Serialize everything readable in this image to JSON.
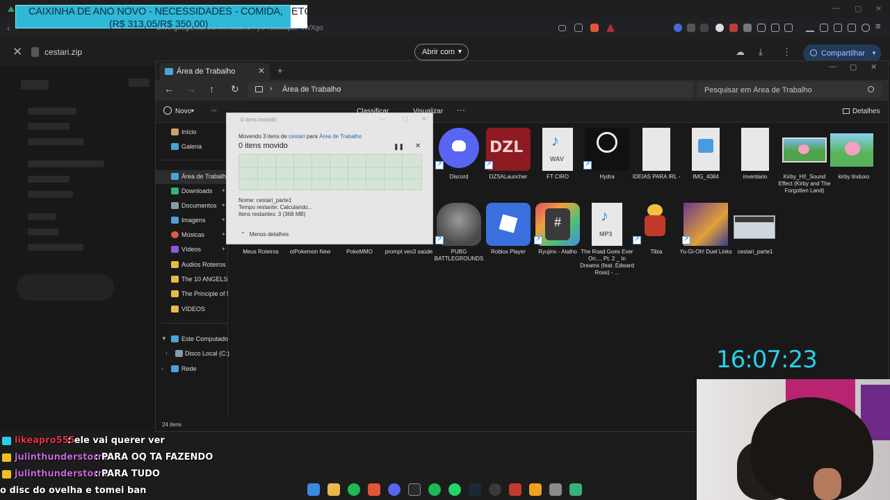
{
  "overlay": {
    "donation_line1": "CAIXINHA DE ANO NOVO - NECESSIDADES - COMIDA,",
    "donation_tail": "ETC.",
    "donation_line2": "(R$ 313,05/R$ 350,00)",
    "clock": "16:07:23"
  },
  "browser": {
    "url": "drive.google.com/drive/folders/...ys/Ts5txbqSIPllWXgo"
  },
  "drive": {
    "file_name": "cestari.zip",
    "open_with_label": "Abrir com",
    "share_label": "Compartilhar"
  },
  "explorer": {
    "tab_title": "Área de Trabalho",
    "path": "Área de Trabalho",
    "search_placeholder": "Pesquisar em Área de Trabalho",
    "new_label": "Novo",
    "sort_label": "Classificar",
    "view_label": "Visualizar",
    "details_label": "Detalhes",
    "status": "24 itens",
    "sidebar": [
      {
        "label": "Início",
        "icon": "home-icon"
      },
      {
        "label": "Galeria",
        "icon": "gallery-icon"
      },
      {
        "label": "Área de Trabalho",
        "icon": "desktop-icon"
      },
      {
        "label": "Downloads",
        "icon": "download-icon"
      },
      {
        "label": "Documentos",
        "icon": "documents-icon"
      },
      {
        "label": "Imagens",
        "icon": "images-icon"
      },
      {
        "label": "Músicas",
        "icon": "music-icon"
      },
      {
        "label": "Vídeos",
        "icon": "video-icon"
      },
      {
        "label": "Audios Roteiros",
        "icon": "folder-icon"
      },
      {
        "label": "The 10 ANGELS Tha",
        "icon": "folder-icon"
      },
      {
        "label": "The Principle of ME",
        "icon": "folder-icon"
      },
      {
        "label": "VIDEOS",
        "icon": "folder-icon"
      },
      {
        "label": "Este Computador",
        "icon": "computer-icon"
      },
      {
        "label": "Disco Local (C:)",
        "icon": "drive-icon"
      },
      {
        "label": "Rede",
        "icon": "network-icon"
      }
    ],
    "files_row1": [
      {
        "name": "Discord",
        "icon": "discord-icon",
        "color": "#5865f2"
      },
      {
        "name": "DZSALauncher",
        "icon": "dzsa-icon",
        "color": "#8e1a22"
      },
      {
        "name": "FT CIRO",
        "icon": "wav-file-icon",
        "color": "#e8e8e8"
      },
      {
        "name": "Hydra",
        "icon": "hydra-icon",
        "color": "#111111"
      },
      {
        "name": "IDEIAS PARA IRL -",
        "icon": "text-file-icon",
        "color": "#e8e8e8"
      },
      {
        "name": "IMG_4084",
        "icon": "image-file-icon",
        "color": "#e8e8e8"
      },
      {
        "name": "inventario",
        "icon": "text-file-icon",
        "color": "#e8e8e8"
      },
      {
        "name": "Kirby_HI!_Sound Effect (Kirby and The Forgotten Land)",
        "icon": "kirby-thumb-icon",
        "color": "#4fa34a"
      },
      {
        "name": "kirby linduxo",
        "icon": "kirby-thumb-icon",
        "color": "#59b35a"
      }
    ],
    "files_row2": [
      {
        "name": "Meus Roteiros",
        "icon": "folder-icon",
        "color": "#e8b84a"
      },
      {
        "name": "otPokemon New",
        "icon": "shortcut-icon",
        "color": "#444444"
      },
      {
        "name": "PokeMMO",
        "icon": "shortcut-icon",
        "color": "#444444"
      },
      {
        "name": "prompt veo3 saúde",
        "icon": "text-file-icon",
        "color": "#e8e8e8"
      },
      {
        "name": "PUBG BATTLEGROUNDS",
        "icon": "pubg-icon",
        "color": "#6a6a6a"
      },
      {
        "name": "Roblox Player",
        "icon": "roblox-icon",
        "color": "#3a6fe0"
      },
      {
        "name": "Ryujinx - Atalho",
        "icon": "ryujinx-icon",
        "color": "#c44a6a"
      },
      {
        "name": "The Road Goes Ever On..., Pt. 2 _ In Dreams (feat. Edward Ross) - ...",
        "icon": "mp3-file-icon",
        "color": "#e8e8e8"
      },
      {
        "name": "Tibia",
        "icon": "tibia-icon",
        "color": "#c23a2a"
      },
      {
        "name": "Yu-Gi-Oh! Duel Links",
        "icon": "yugioh-icon",
        "color": "#7a3a8a"
      },
      {
        "name": "cestari_parte1",
        "icon": "folder-thumb-icon",
        "color": "#8a8a8a"
      }
    ]
  },
  "copy_dialog": {
    "title": "0 itens movido",
    "moving_prefix": "Movendo 3 itens de ",
    "source": "cestari",
    "to": " para ",
    "dest": "Área de Trabalho",
    "heading": "0 itens movido",
    "name_line": "Nome: cestari_parte1",
    "time_line": "Tempo restante: Calculando...",
    "items_line": "Itens restantes: 3 (368 MB)",
    "less_details": "Menos detalhes"
  },
  "chat": [
    {
      "user": "likeapro555",
      "msg": ": ele vai querer ver",
      "user_color": "#e0334a",
      "badge_color": "#29cfe8"
    },
    {
      "user": "julinthunderstorm",
      "msg": ": PARA OQ TA FAZENDO",
      "user_color": "#c06ad8",
      "badge_color": "#f0c020"
    },
    {
      "user": "julinthunderstorm",
      "msg": ": PARA TUDO",
      "user_color": "#c06ad8",
      "badge_color": "#f0c020"
    },
    {
      "user": "",
      "msg": "o disc do ovelha e tomei ban",
      "user_color": "#ffffff",
      "badge_color": ""
    }
  ]
}
